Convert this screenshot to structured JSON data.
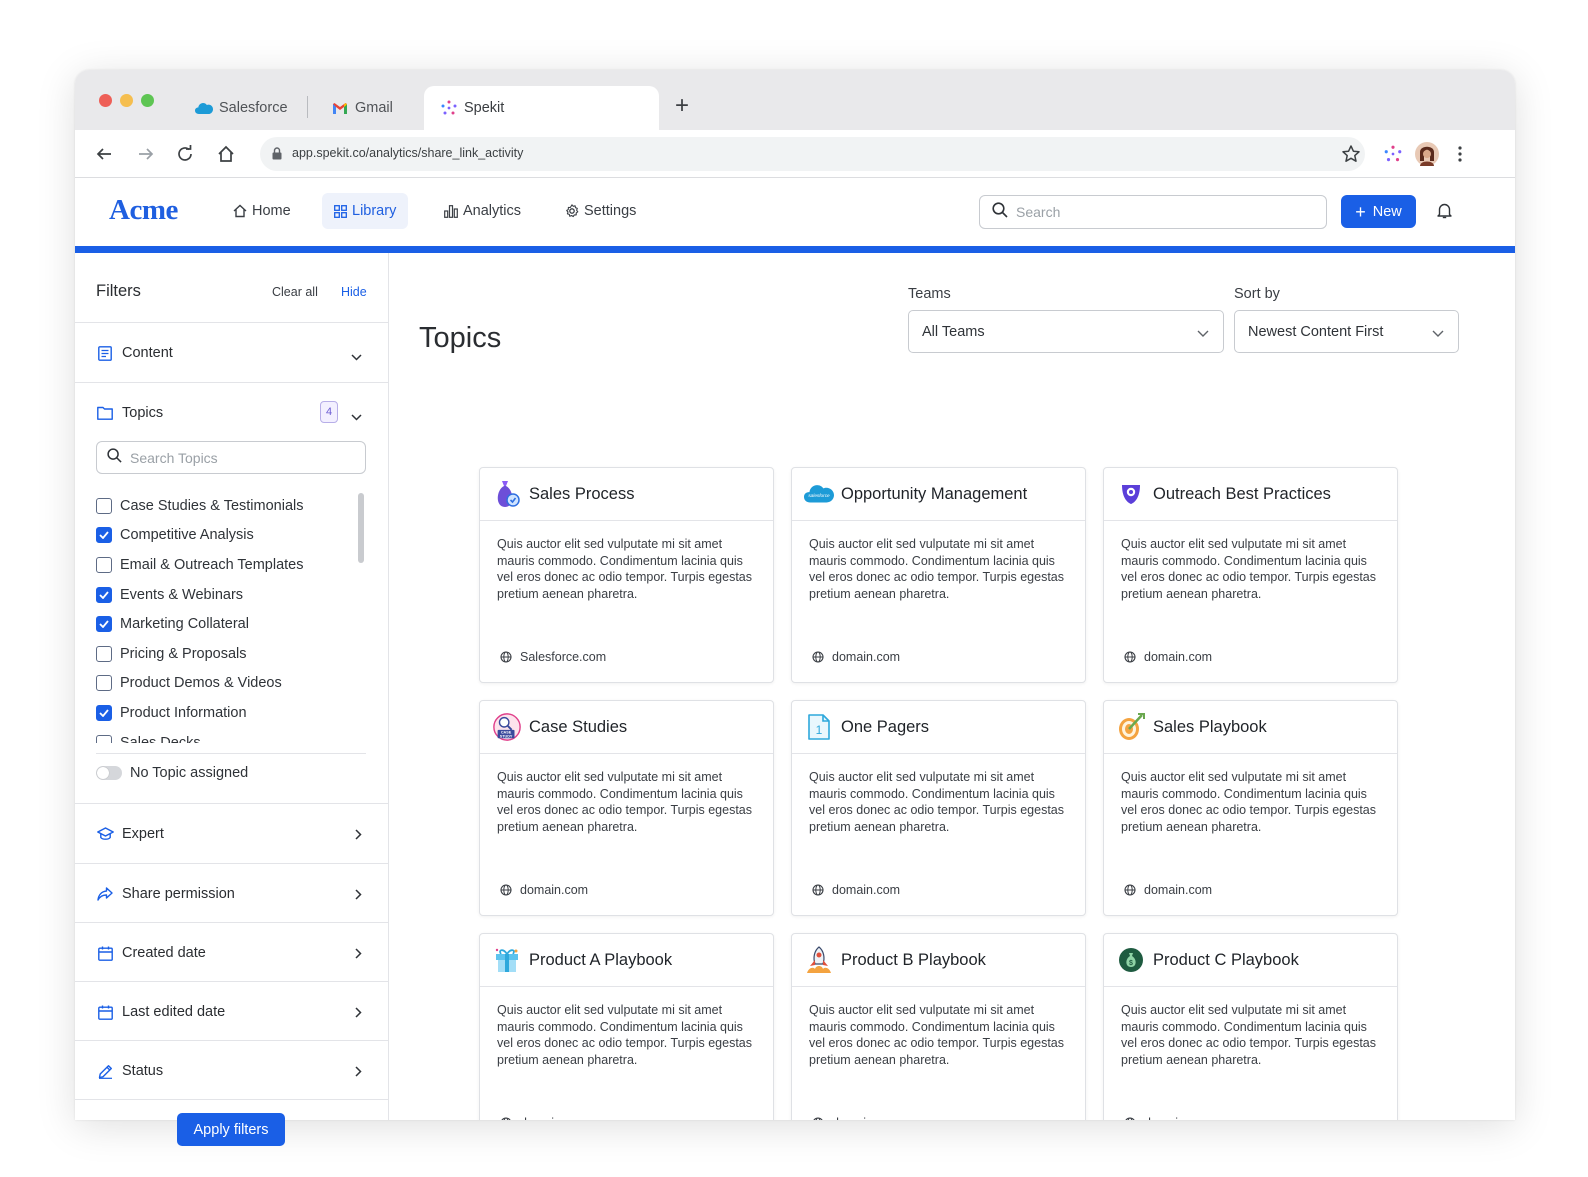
{
  "browser": {
    "tabs": [
      {
        "label": "Salesforce",
        "icon": "salesforce-cloud-icon"
      },
      {
        "label": "Gmail",
        "icon": "gmail-icon"
      },
      {
        "label": "Spekit",
        "icon": "spekit-icon"
      }
    ],
    "active_tab": 2,
    "url": "app.spekit.co/analytics/share_link_activity"
  },
  "header": {
    "logo": "Acme",
    "nav": [
      {
        "label": "Home",
        "icon": "home-icon"
      },
      {
        "label": "Library",
        "icon": "grid-icon"
      },
      {
        "label": "Analytics",
        "icon": "bar-chart-icon"
      },
      {
        "label": "Settings",
        "icon": "gear-icon"
      }
    ],
    "active_nav": 1,
    "search_placeholder": "Search",
    "new_label": "New",
    "accent": "#1a5fe6"
  },
  "filters": {
    "title": "Filters",
    "clear_all": "Clear all",
    "hide": "Hide",
    "content_label": "Content",
    "topics_label": "Topics",
    "topics_count": "4",
    "topic_search_placeholder": "Search Topics",
    "topics": [
      {
        "label": "Case Studies & Testimonials",
        "checked": false
      },
      {
        "label": "Competitive Analysis",
        "checked": true
      },
      {
        "label": "Email & Outreach Templates",
        "checked": false
      },
      {
        "label": "Events & Webinars",
        "checked": true
      },
      {
        "label": "Marketing Collateral",
        "checked": true
      },
      {
        "label": "Pricing & Proposals",
        "checked": false
      },
      {
        "label": "Product Demos & Videos",
        "checked": false
      },
      {
        "label": "Product Information",
        "checked": true
      },
      {
        "label": "Sales Decks",
        "checked": false
      }
    ],
    "no_topic_label": "No Topic assigned",
    "no_topic_on": false,
    "sections": [
      {
        "label": "Expert",
        "icon": "graduation-cap-icon"
      },
      {
        "label": "Share permission",
        "icon": "share-icon"
      },
      {
        "label": "Created date",
        "icon": "calendar-icon"
      },
      {
        "label": "Last edited date",
        "icon": "calendar-icon"
      },
      {
        "label": "Status",
        "icon": "pencil-icon"
      }
    ],
    "apply_label": "Apply filters"
  },
  "main": {
    "title": "Topics",
    "teams_label": "Teams",
    "teams_value": "All Teams",
    "sort_label": "Sort by",
    "sort_value": "Newest Content First",
    "cards": [
      {
        "title": "Sales Process",
        "icon": "money-bag-icon",
        "body": "Quis auctor elit sed vulputate mi sit amet mauris commodo. Condimentum lacinia quis vel eros donec ac odio tempor. Turpis egestas pretium aenean pharetra.",
        "domain": "Salesforce.com"
      },
      {
        "title": "Opportunity Management",
        "icon": "salesforce-cloud-icon",
        "body": "Quis auctor elit sed vulputate mi sit amet mauris commodo. Condimentum lacinia quis vel eros donec ac odio tempor. Turpis egestas pretium aenean pharetra.",
        "domain": "domain.com"
      },
      {
        "title": "Outreach Best Practices",
        "icon": "outreach-shield-icon",
        "body": "Quis auctor elit sed vulputate mi sit amet mauris commodo. Condimentum lacinia quis vel eros donec ac odio tempor. Turpis egestas pretium aenean pharetra.",
        "domain": "domain.com"
      },
      {
        "title": "Case Studies",
        "icon": "case-study-icon",
        "body": "Quis auctor elit sed vulputate mi sit amet mauris commodo. Condimentum lacinia quis vel eros donec ac odio tempor. Turpis egestas pretium aenean pharetra.",
        "domain": "domain.com"
      },
      {
        "title": "One Pagers",
        "icon": "one-page-document-icon",
        "body": "Quis auctor elit sed vulputate mi sit amet mauris commodo. Condimentum lacinia quis vel eros donec ac odio tempor. Turpis egestas pretium aenean pharetra.",
        "domain": "domain.com"
      },
      {
        "title": "Sales Playbook",
        "icon": "target-icon",
        "body": "Quis auctor elit sed vulputate mi sit amet mauris commodo. Condimentum lacinia quis vel eros donec ac odio tempor. Turpis egestas pretium aenean pharetra.",
        "domain": "domain.com"
      },
      {
        "title": "Product A Playbook",
        "icon": "gift-box-icon",
        "body": "Quis auctor elit sed vulputate mi sit amet mauris commodo. Condimentum lacinia quis vel eros donec ac odio tempor. Turpis egestas pretium aenean pharetra.",
        "domain": "domain.com"
      },
      {
        "title": "Product B Playbook",
        "icon": "rocket-icon",
        "body": "Quis auctor elit sed vulputate mi sit amet mauris commodo. Condimentum lacinia quis vel eros donec ac odio tempor. Turpis egestas pretium aenean pharetra.",
        "domain": "domain.com"
      },
      {
        "title": "Product C Playbook",
        "icon": "money-bag-dark-icon",
        "body": "Quis auctor elit sed vulputate mi sit amet mauris commodo. Condimentum lacinia quis vel eros donec ac odio tempor. Turpis egestas pretium aenean pharetra.",
        "domain": "domain.com"
      }
    ]
  }
}
